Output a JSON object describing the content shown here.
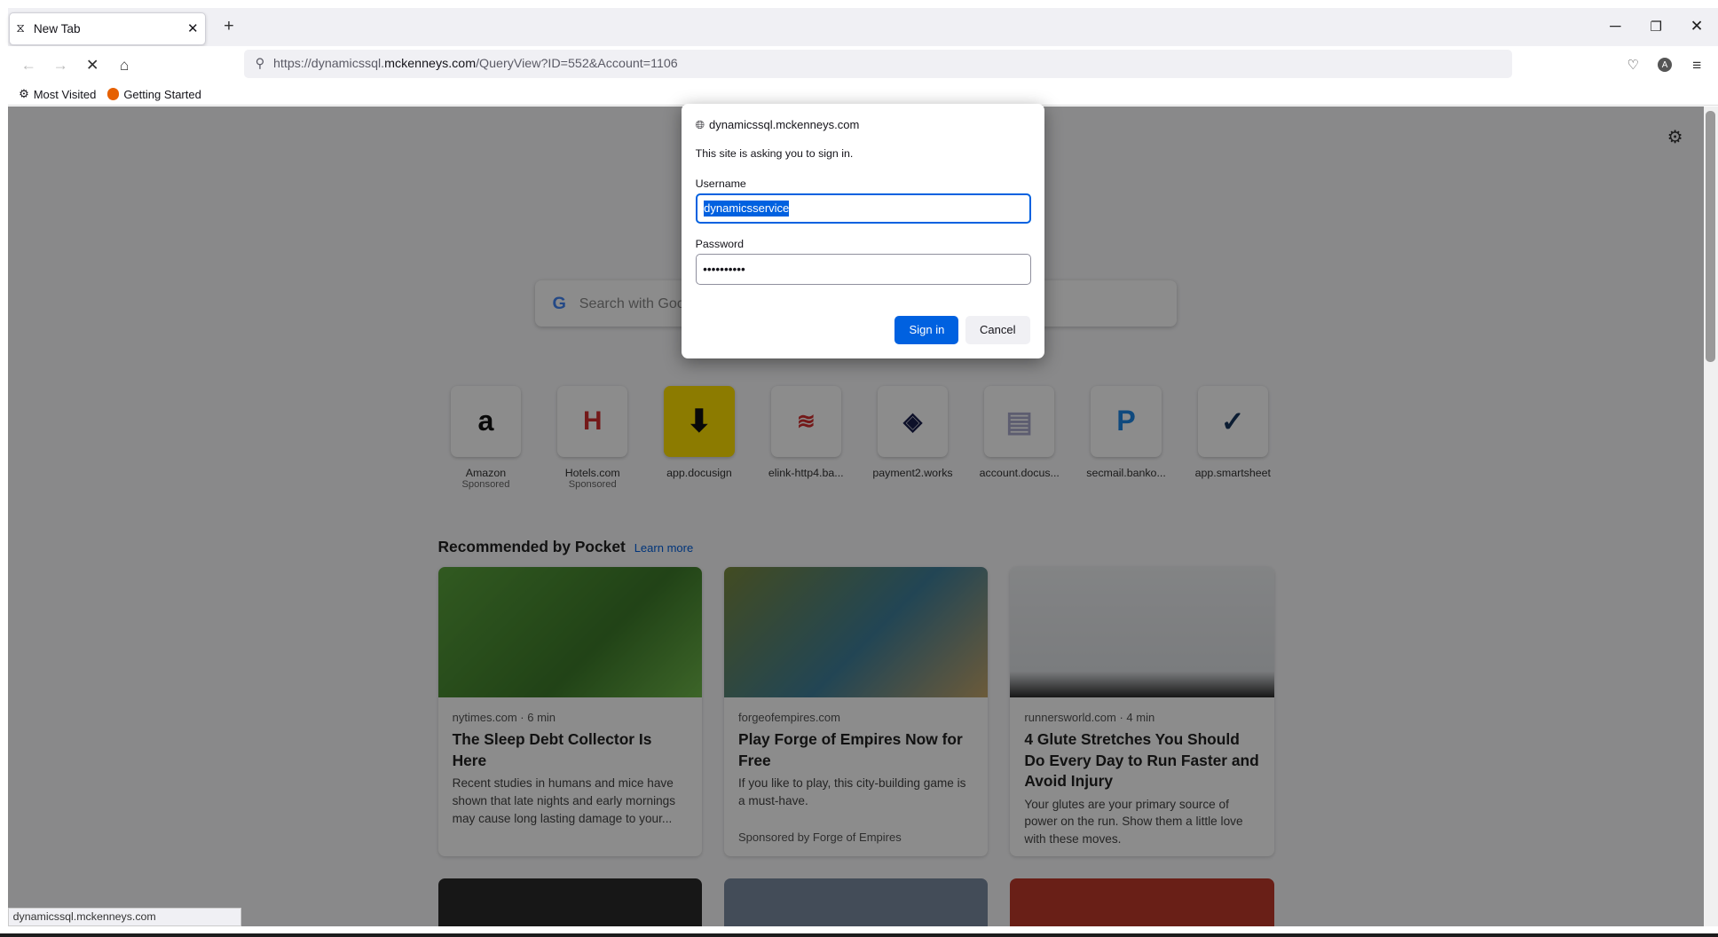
{
  "browser": {
    "tab_title": "New Tab",
    "url_prefix": "https://dynamicssql.",
    "url_host": "mckenneys.com",
    "url_path": "/QueryView?ID=552&Account=1106",
    "bookmarks": [
      {
        "label": "Most Visited",
        "icon": "gear-icon"
      },
      {
        "label": "Getting Started",
        "icon": "firefox-icon"
      }
    ]
  },
  "newtab": {
    "search_placeholder": "Search with Goo",
    "tiles": [
      {
        "label": "Amazon",
        "sub": "Sponsored",
        "icon": "amazon-icon",
        "color": "#ffffff",
        "glyph": "a"
      },
      {
        "label": "Hotels.com",
        "sub": "Sponsored",
        "icon": "hotels-icon",
        "color": "#ffffff",
        "glyph": "H"
      },
      {
        "label": "app.docusign",
        "sub": "",
        "icon": "download-icon",
        "color": "#ffe000",
        "glyph": "⬇"
      },
      {
        "label": "elink-http4.ba...",
        "sub": "",
        "icon": "bank-flag-icon",
        "color": "#ffffff",
        "glyph": "≋"
      },
      {
        "label": "payment2.works",
        "sub": "",
        "icon": "payment-icon",
        "color": "#1a1f4d",
        "glyph": "◈"
      },
      {
        "label": "account.docus...",
        "sub": "",
        "icon": "document-icon",
        "color": "#ffffff",
        "glyph": "▤"
      },
      {
        "label": "secmail.banko...",
        "sub": "",
        "icon": "p-icon",
        "color": "#1e88e5",
        "glyph": "P"
      },
      {
        "label": "app.smartsheet",
        "sub": "",
        "icon": "smartsheet-icon",
        "color": "#17365d",
        "glyph": "✓"
      }
    ],
    "pocket_title": "Recommended by Pocket",
    "pocket_link": "Learn more",
    "cards": [
      {
        "source": "nytimes.com · 6 min",
        "title": "The Sleep Debt Collector Is Here",
        "excerpt": "Recent studies in humans and mice have shown that late nights and early mornings may cause long lasting damage to your...",
        "sponsor": ""
      },
      {
        "source": "forgeofempires.com",
        "title": "Play Forge of Empires Now for Free",
        "excerpt": "If you like to play, this city-building game is a must-have.",
        "sponsor": "Sponsored by Forge of Empires"
      },
      {
        "source": "runnersworld.com · 4 min",
        "title": "4 Glute Stretches You Should Do Every Day to Run Faster and Avoid Injury",
        "excerpt": "Your glutes are your primary source of power on the run. Show them a little love with these moves.",
        "sponsor": ""
      }
    ],
    "status_url": "dynamicssql.mckenneys.com"
  },
  "dialog": {
    "host": "dynamicssql.mckenneys.com",
    "message": "This site is asking you to sign in.",
    "username_label": "Username",
    "username_value": "dynamicsservice",
    "password_label": "Password",
    "password_value": "••••••••••",
    "signin_label": "Sign in",
    "cancel_label": "Cancel"
  }
}
